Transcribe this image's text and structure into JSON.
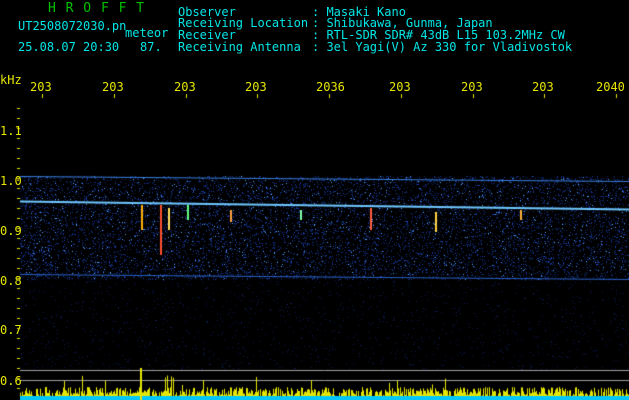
{
  "header": {
    "brand": "H R O F F T",
    "filename": "UT2508072030.pn",
    "category": "meteor",
    "datetime": "25.08.07 20:30",
    "count": "87.",
    "fields": [
      {
        "label": "Observer",
        "value": ": Masaki Kano"
      },
      {
        "label": "Receiving Location",
        "value": ": Shibukawa, Gunma, Japan"
      },
      {
        "label": "Receiver",
        "value": ": RTL-SDR SDR# 43dB L15 103.2MHz CW"
      },
      {
        "label": "Receiving Antenna",
        "value": ": 3el Yagi(V) Az 330 for Vladivostok"
      }
    ]
  },
  "axes": {
    "y_unit": "kHz",
    "y_ticks": [
      "1.1",
      "1.0",
      "0.9",
      "0.8",
      "0.7",
      "0.6"
    ],
    "x_ticks": [
      "203",
      "203",
      "203",
      "203",
      "2036",
      "203",
      "203",
      "203",
      "2040"
    ]
  },
  "colors": {
    "background": "#000000",
    "text_cyan": "#00e6e6",
    "text_yellow": "#e6e600",
    "brand_green": "#00c000",
    "signal": "#4fb8ff"
  }
}
